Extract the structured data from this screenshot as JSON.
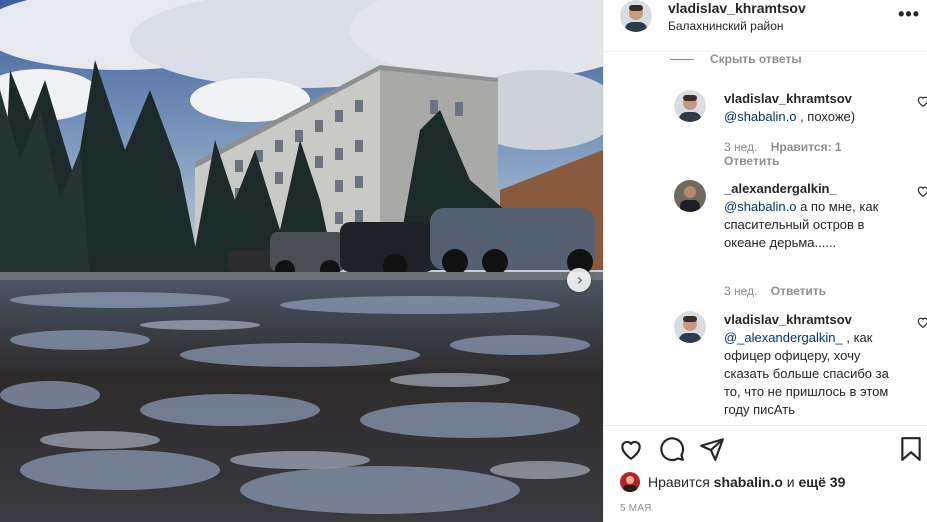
{
  "post": {
    "author": "vladislav_khramtsov",
    "location": "Балахнинский район",
    "more_icon": "more-horizontal-icon"
  },
  "comments": {
    "hide_replies_label": "Скрыть ответы",
    "items": [
      {
        "author": "vladislav_khramtsov",
        "mention": "@shabalin.o",
        "text": " , похоже)",
        "time": "3 нед.",
        "likes": "Нравится: 1",
        "reply_label": "Ответить"
      },
      {
        "author": "_alexandergalkin_",
        "mention": "@shabalin.o",
        "text": " а по мне, как спасительный остров в океане дерьма......",
        "time": "3 нед.",
        "reply_label": "Ответить"
      },
      {
        "author": "vladislav_khramtsov",
        "mention": "@_alexandergalkin_",
        "text": " , как офицер офицеру, хочу сказать больше спасибо за то, что не пришлось в этом году писАть"
      }
    ]
  },
  "actions": {
    "like_icon": "heart-icon",
    "comment_icon": "comment-icon",
    "share_icon": "send-icon",
    "save_icon": "bookmark-icon"
  },
  "likes": {
    "prefix": "Нравится",
    "user": "shabalin.o",
    "connector": "и",
    "others": "ещё 39"
  },
  "date": "5 МАЯ",
  "colors": {
    "mention": "#00376b",
    "secondary_text": "#8e8e8e",
    "border": "#efefef"
  }
}
